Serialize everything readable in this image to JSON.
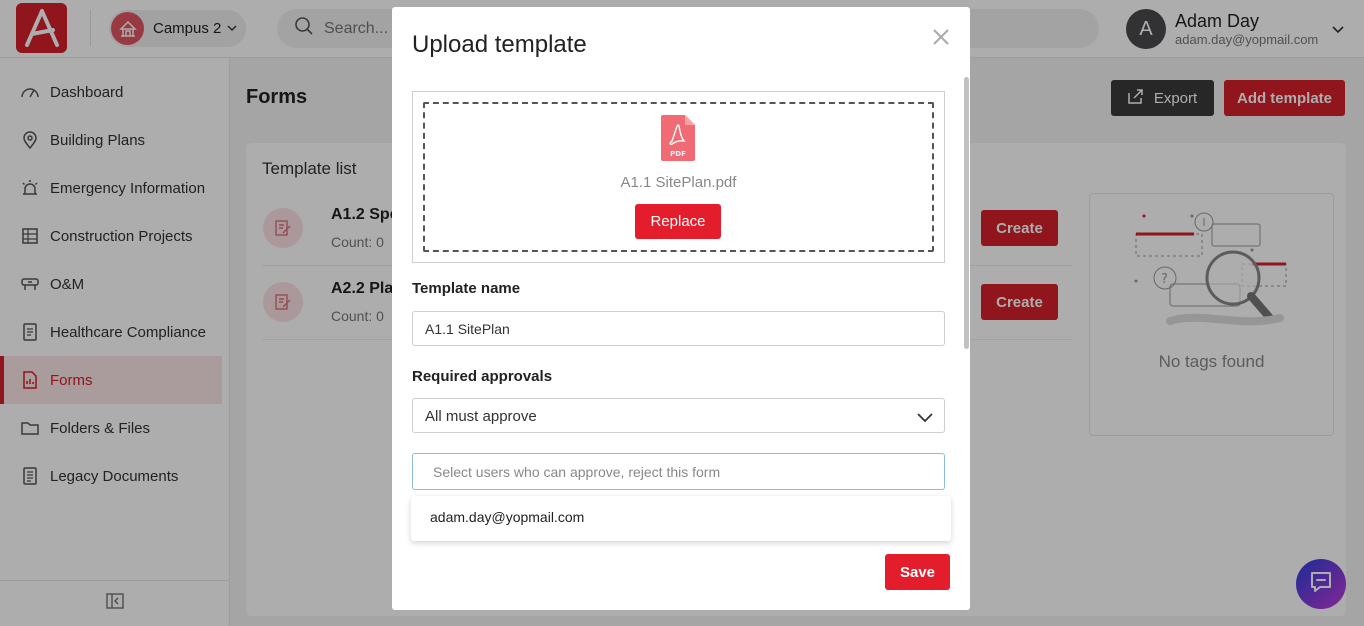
{
  "header": {
    "campus_label": "Campus 2",
    "search_placeholder": "Search...",
    "user_initial": "A",
    "user_name": "Adam Day",
    "user_email": "adam.day@yopmail.com"
  },
  "sidebar": {
    "items": [
      {
        "label": "Dashboard",
        "icon": "dashboard-icon"
      },
      {
        "label": "Building Plans",
        "icon": "map-pin-icon"
      },
      {
        "label": "Emergency Information",
        "icon": "alarm-icon"
      },
      {
        "label": "Construction Projects",
        "icon": "construction-icon"
      },
      {
        "label": "O&M",
        "icon": "tools-icon"
      },
      {
        "label": "Healthcare Compliance",
        "icon": "checklist-icon"
      },
      {
        "label": "Forms",
        "icon": "forms-icon",
        "active": true
      },
      {
        "label": "Folders & Files",
        "icon": "folder-icon"
      },
      {
        "label": "Legacy Documents",
        "icon": "document-icon"
      }
    ]
  },
  "main": {
    "title": "Forms",
    "export_label": "Export",
    "add_label": "Add template",
    "list_title": "Template list",
    "templates": [
      {
        "name": "A1.2 Spe",
        "count": "Count: 0",
        "create_label": "Create"
      },
      {
        "name": "A2.2 Pla",
        "count": "Count: 0",
        "create_label": "Create"
      }
    ],
    "tags_empty": "No tags found"
  },
  "modal": {
    "title": "Upload template",
    "file_name": "A1.1 SitePlan.pdf",
    "pdf_badge": "PDF",
    "replace_label": "Replace",
    "template_name_label": "Template name",
    "template_name_value": "A1.1 SitePlan",
    "approvals_label": "Required approvals",
    "approvals_value": "All must approve",
    "approvers_placeholder": "Select users who can approve, reject this form",
    "approver_option": "adam.day@yopmail.com",
    "save_label": "Save"
  },
  "colors": {
    "brand_red": "#d51f2b",
    "dark_button": "#3a3a3b"
  }
}
